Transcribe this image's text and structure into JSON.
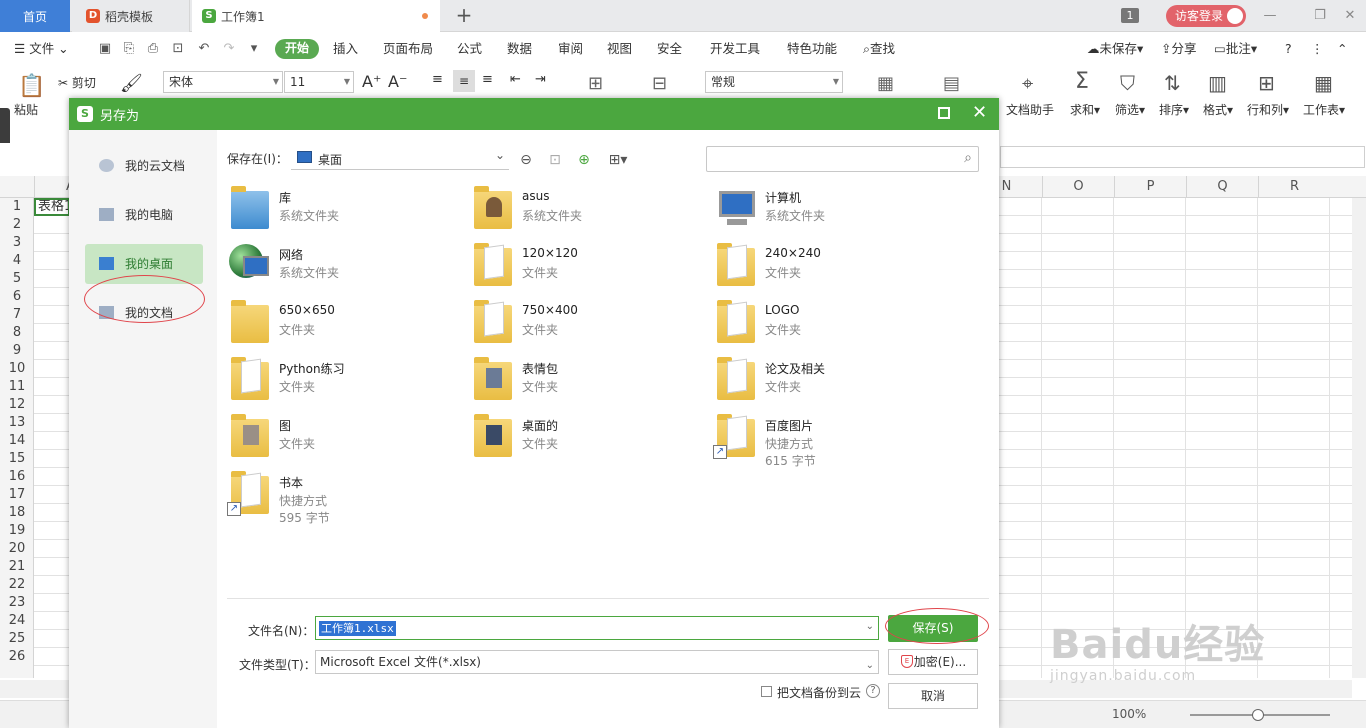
{
  "tabs": {
    "home": "首页",
    "template": "稻壳模板",
    "workbook": "工作簿1",
    "badge": "1",
    "visitor": "访客登录"
  },
  "menu": {
    "file": "文件",
    "items": [
      "开始",
      "插入",
      "页面布局",
      "公式",
      "数据",
      "审阅",
      "视图",
      "安全",
      "开发工具",
      "特色功能"
    ],
    "search": "查找",
    "unsaved": "未保存",
    "share": "分享",
    "comment": "批注"
  },
  "ribbon": {
    "paste": "粘贴",
    "cut": "剪切",
    "font_name": "宋体",
    "font_size": "11",
    "number_format": "常规",
    "right_tools": [
      "文档助手",
      "求和",
      "筛选",
      "排序",
      "格式",
      "行和列",
      "工作表"
    ]
  },
  "sheet": {
    "columns": [
      "A",
      "N",
      "O",
      "P",
      "Q",
      "R"
    ],
    "rows": [
      "1",
      "2",
      "3",
      "4",
      "5",
      "6",
      "7",
      "8",
      "9",
      "10",
      "11",
      "12",
      "13",
      "14",
      "15",
      "16",
      "17",
      "18",
      "19",
      "20",
      "21",
      "22",
      "23",
      "24",
      "25",
      "26"
    ],
    "a1": "表格1",
    "zoom": "100%"
  },
  "dialog": {
    "title": "另存为",
    "sidebar": [
      "我的云文档",
      "我的电脑",
      "我的桌面",
      "我的文档"
    ],
    "save_in_label": "保存在(I)：",
    "location": "桌面",
    "search_placeholder": "",
    "files": [
      {
        "name": "库",
        "type": "系统文件夹",
        "size": ""
      },
      {
        "name": "asus",
        "type": "系统文件夹",
        "size": ""
      },
      {
        "name": "计算机",
        "type": "系统文件夹",
        "size": ""
      },
      {
        "name": "网络",
        "type": "系统文件夹",
        "size": ""
      },
      {
        "name": "120×120",
        "type": "文件夹",
        "size": ""
      },
      {
        "name": "240×240",
        "type": "文件夹",
        "size": ""
      },
      {
        "name": "650×650",
        "type": "文件夹",
        "size": ""
      },
      {
        "name": "750×400",
        "type": "文件夹",
        "size": ""
      },
      {
        "name": "LOGO",
        "type": "文件夹",
        "size": ""
      },
      {
        "name": "Python练习",
        "type": "文件夹",
        "size": ""
      },
      {
        "name": "表情包",
        "type": "文件夹",
        "size": ""
      },
      {
        "name": "论文及相关",
        "type": "文件夹",
        "size": ""
      },
      {
        "name": "图",
        "type": "文件夹",
        "size": ""
      },
      {
        "name": "桌面的",
        "type": "文件夹",
        "size": ""
      },
      {
        "name": "百度图片",
        "type": "快捷方式",
        "size": "615 字节"
      },
      {
        "name": "书本",
        "type": "快捷方式",
        "size": "595 字节"
      }
    ],
    "filename_label": "文件名(N)：",
    "filename": "工作簿1.xlsx",
    "filetype_label": "文件类型(T)：",
    "filetype": "Microsoft Excel 文件(*.xlsx)",
    "save_button": "保存(S)",
    "encrypt_button": "加密(E)...",
    "cancel_button": "取消",
    "cloud_backup": "把文档备份到云"
  },
  "watermark": {
    "logo": "Baidu经验",
    "url": "jingyan.baidu.com"
  },
  "colors": {
    "accent": "#4ba73f",
    "home_tab": "#3f7fd7",
    "highlight": "#e0454b"
  }
}
